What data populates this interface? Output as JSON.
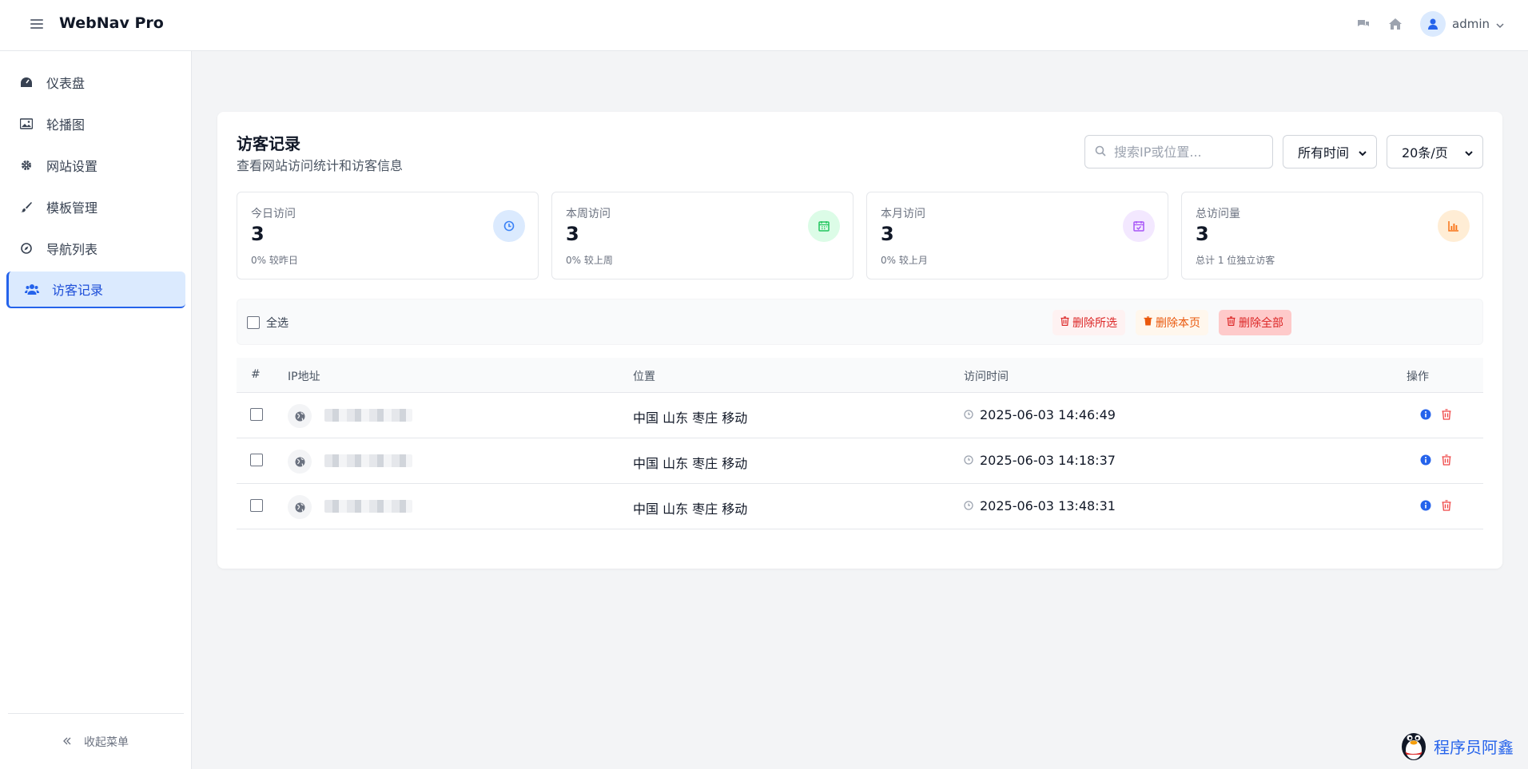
{
  "header": {
    "brand": "WebNav Pro",
    "username": "admin"
  },
  "sidebar": {
    "items": [
      {
        "label": "仪表盘"
      },
      {
        "label": "轮播图"
      },
      {
        "label": "网站设置"
      },
      {
        "label": "模板管理"
      },
      {
        "label": "导航列表"
      },
      {
        "label": "访客记录"
      }
    ],
    "active_index": 5,
    "collapse_label": "收起菜单"
  },
  "page": {
    "title": "访客记录",
    "subtitle": "查看网站访问统计和访客信息",
    "search_placeholder": "搜索IP或位置...",
    "time_filter": "所有时间",
    "page_size": "20条/页"
  },
  "stats": [
    {
      "label": "今日访问",
      "value": "3",
      "compare": "0% 较昨日",
      "icon": "clock-icon",
      "color": "#3b82f6"
    },
    {
      "label": "本周访问",
      "value": "3",
      "compare": "0% 较上周",
      "icon": "calendar-icon",
      "color": "#22c55e"
    },
    {
      "label": "本月访问",
      "value": "3",
      "compare": "0% 较上月",
      "icon": "calendar-check-icon",
      "color": "#a855f7"
    },
    {
      "label": "总访问量",
      "value": "3",
      "compare": "总计 1 位独立访客",
      "icon": "bar-chart-icon",
      "color": "#f97316"
    }
  ],
  "bulk": {
    "select_all": "全选",
    "delete_selected": "删除所选",
    "delete_page": "删除本页",
    "delete_all": "删除全部"
  },
  "table": {
    "headers": {
      "num": "#",
      "ip": "IP地址",
      "location": "位置",
      "time": "访问时间",
      "actions": "操作"
    },
    "rows": [
      {
        "location": "中国 山东 枣庄 移动",
        "time": "2025-06-03 14:46:49"
      },
      {
        "location": "中国 山东 枣庄 移动",
        "time": "2025-06-03 14:18:37"
      },
      {
        "location": "中国 山东 枣庄 移动",
        "time": "2025-06-03 13:48:31"
      }
    ]
  },
  "watermark": "程序员阿鑫",
  "colors": {
    "accent": "#2563eb",
    "danger": "#dc2626",
    "warning": "#ea580c"
  }
}
